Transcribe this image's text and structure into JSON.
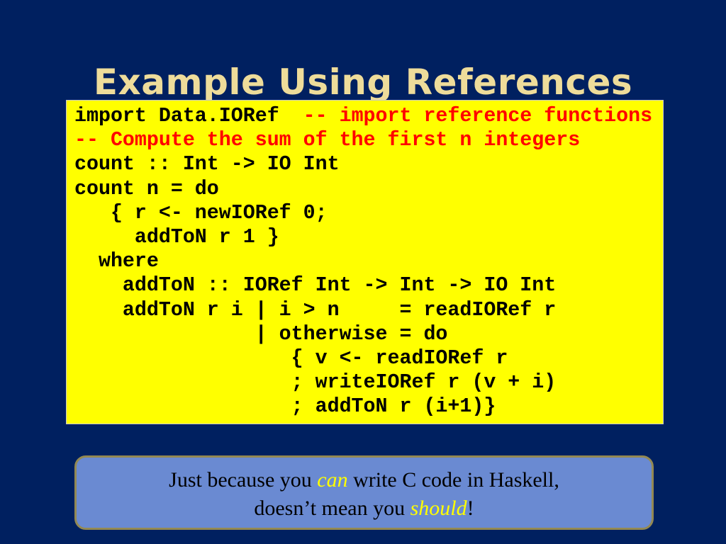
{
  "slide": {
    "title": "Example Using References",
    "colors": {
      "background": "#002060",
      "title": "#EEDC9A",
      "code_background": "#FFFF00",
      "code_text": "#000000",
      "comment": "#FF0000",
      "callout_background": "#6A8AD2",
      "callout_border": "#938953",
      "emphasis": "#FFFF00"
    }
  },
  "code": {
    "lines": [
      {
        "code": "import Data.IORef  ",
        "comment": "-- import reference functions"
      },
      {
        "code": "",
        "comment": "-- Compute the sum of the first n integers"
      },
      {
        "code": "count :: Int -> IO Int",
        "comment": ""
      },
      {
        "code": "count n = do",
        "comment": ""
      },
      {
        "code": "   { r <- newIORef 0;",
        "comment": ""
      },
      {
        "code": "     addToN r 1 }",
        "comment": ""
      },
      {
        "code": "  where",
        "comment": ""
      },
      {
        "code": "    addToN :: IORef Int -> Int -> IO Int",
        "comment": ""
      },
      {
        "code": "    addToN r i | i > n     = readIORef r",
        "comment": ""
      },
      {
        "code": "               | otherwise = do",
        "comment": ""
      },
      {
        "code": "                  { v <- readIORef r",
        "comment": ""
      },
      {
        "code": "                  ; writeIORef r (v + i)",
        "comment": ""
      },
      {
        "code": "                  ; addToN r (i+1)}",
        "comment": ""
      }
    ]
  },
  "callout": {
    "line1": {
      "before": "Just  because  you ",
      "emphasis": "can",
      "after": " write C code in Haskell,"
    },
    "line2": {
      "before": "doesn’t mean you ",
      "emphasis": "should",
      "after": "!"
    }
  }
}
